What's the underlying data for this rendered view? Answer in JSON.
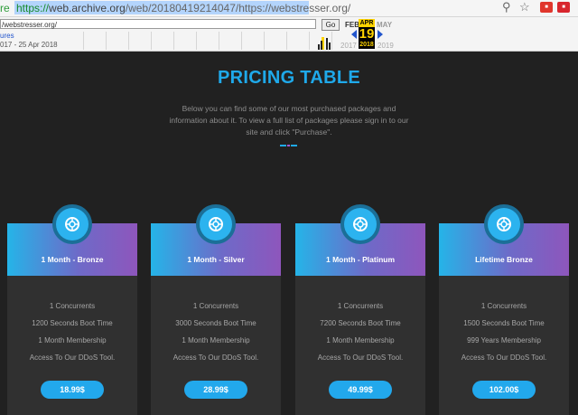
{
  "browser": {
    "left_fragment": "re",
    "url_scheme": "https://",
    "url_host": "web.archive.org",
    "url_path": "/web/20180419214047/https://webstresser.org/"
  },
  "wayback": {
    "input_value": "/webstresser.org/",
    "go_label": "Go",
    "captures_label": "ures",
    "range_label": "017 - 25 Apr 2018",
    "months": {
      "prev": "FEB",
      "current": "APR",
      "next": "MAY"
    },
    "day": "19",
    "years": {
      "prev": "2017",
      "current": "2018",
      "next": "2019"
    }
  },
  "page": {
    "title": "PRICING TABLE",
    "intro_lines": [
      "Below you can find some of our most purchased packages and",
      "information about it. To view a full list of packages please sign in to our",
      "site and click \"Purchase\"."
    ]
  },
  "plans": [
    {
      "name": "1 Month - Bronze",
      "features": [
        "1 Concurrents",
        "1200 Seconds Boot Time",
        "1 Month Membership",
        "Access To Our DDoS Tool."
      ],
      "price": "18.99$"
    },
    {
      "name": "1 Month - Silver",
      "features": [
        "1 Concurrents",
        "3000 Seconds Boot Time",
        "1 Month Membership",
        "Access To Our DDoS Tool."
      ],
      "price": "28.99$"
    },
    {
      "name": "1 Month - Platinum",
      "features": [
        "1 Concurrents",
        "7200 Seconds Boot Time",
        "1 Month Membership",
        "Access To Our DDoS Tool."
      ],
      "price": "49.99$"
    },
    {
      "name": "Lifetime Bronze",
      "features": [
        "1 Concurrents",
        "1500 Seconds Boot Time",
        "999 Years Membership",
        "Access To Our DDoS Tool."
      ],
      "price": "102.00$"
    }
  ],
  "colors": {
    "accent": "#1fa9ea",
    "gradient_end": "#8e56bc",
    "background": "#212121",
    "card": "#303030"
  },
  "icons": {
    "plan_badge": "life-ring-icon"
  }
}
